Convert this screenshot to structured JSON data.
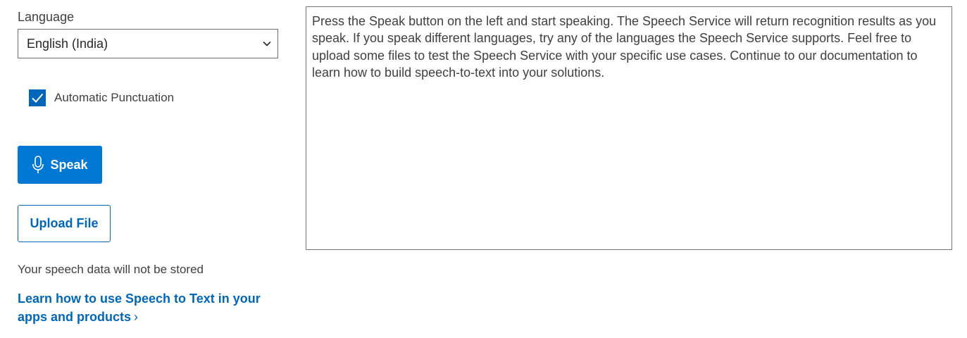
{
  "language": {
    "label": "Language",
    "selected": "English (India)",
    "chevron_icon": "chevron-down-icon"
  },
  "punctuation": {
    "label": "Automatic Punctuation",
    "checked": true,
    "check_icon": "checkmark-icon"
  },
  "actions": {
    "speak_label": "Speak",
    "speak_icon": "microphone-icon",
    "upload_label": "Upload File"
  },
  "storage_note": "Your speech data will not be stored",
  "learn_link": {
    "text": "Learn how to use Speech to Text in your apps and products",
    "chevron": "›"
  },
  "results": {
    "text": "Press the Speak button on the left and start speaking. The Speech Service will return recognition results as you speak. If you speak different languages, try any of the languages the Speech Service supports. Feel free to upload some files to test the Speech Service with your specific use cases. Continue to our documentation to learn how to build speech-to-text into your solutions."
  },
  "colors": {
    "accent": "#0078d4",
    "link": "#0067b8",
    "text": "#404040"
  }
}
